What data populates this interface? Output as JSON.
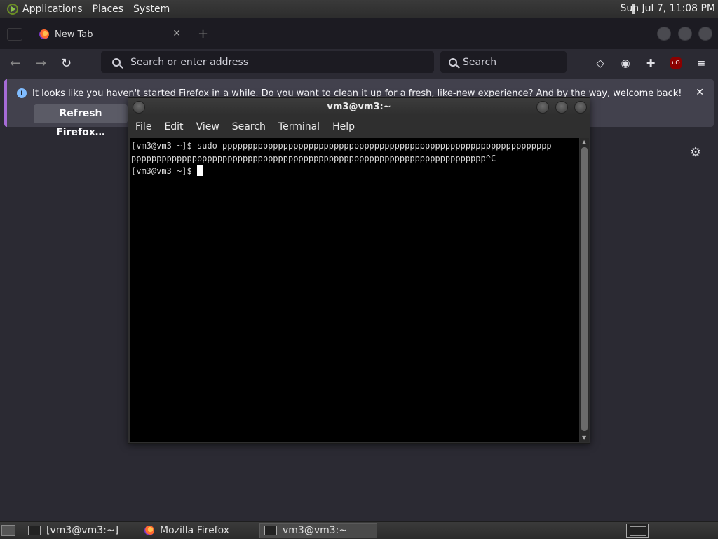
{
  "top_panel": {
    "menus": [
      "Applications",
      "Places",
      "System"
    ],
    "clock": "Sun Jul  7, 11:08 PM"
  },
  "firefox": {
    "tab": {
      "title": "New Tab"
    },
    "urlbar": {
      "placeholder": "Search or enter address"
    },
    "searchbar": {
      "placeholder": "Search"
    },
    "notification": {
      "message": "It looks like you haven't started Firefox in a while. Do you want to clean it up for a fresh, like-new experience? And by the way, welcome back!",
      "button_label": "Refresh Firefox…"
    }
  },
  "terminal": {
    "title": "vm3@vm3:~",
    "menu": [
      "File",
      "Edit",
      "View",
      "Search",
      "Terminal",
      "Help"
    ],
    "lines": [
      "[vm3@vm3 ~]$ sudo ppppppppppppppppppppppppppppppppppppppppppppppppppppppppppppppppp",
      "pppppppppppppppppppppppppppppppppppppppppppppppppppppppppppppppppppppp^C",
      "[vm3@vm3 ~]$ "
    ]
  },
  "taskbar": {
    "tasks": [
      "[vm3@vm3:~]",
      "Mozilla Firefox",
      "vm3@vm3:~"
    ]
  },
  "colors": {
    "firefox_bg": "#2b2a33",
    "notification_bg": "#42414d",
    "terminal_bg": "#000000",
    "terminal_fg": "#d8d8d8"
  }
}
